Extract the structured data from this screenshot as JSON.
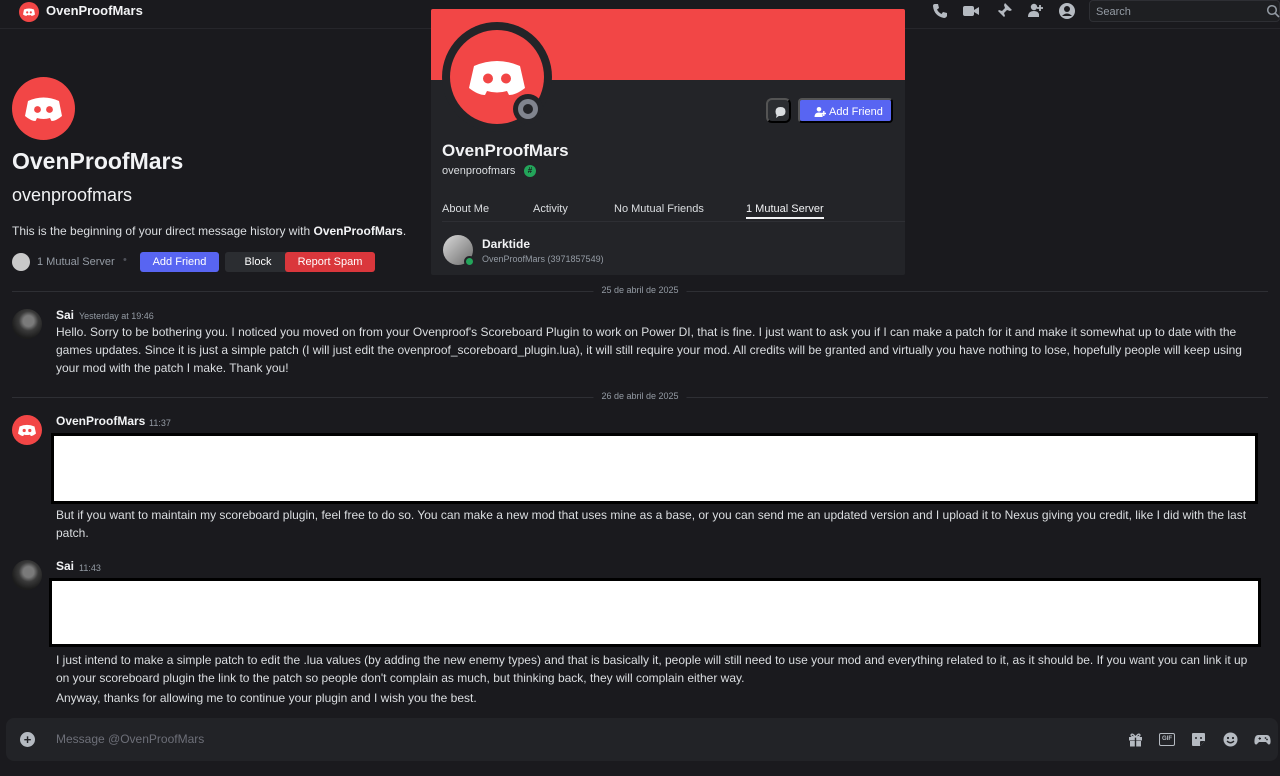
{
  "window": {
    "title": "OvenProofMars"
  },
  "search": {
    "placeholder": "Search"
  },
  "header": {
    "display_name": "OvenProofMars",
    "username": "ovenproofmars",
    "intro_prefix": "This is the beginning of your direct message history with ",
    "intro_name": "OvenProofMars",
    "intro_suffix": ".",
    "mutual_server": "1 Mutual Server",
    "separator": "•",
    "add_friend": "Add Friend",
    "block": "Block",
    "report_spam": "Report Spam"
  },
  "profile_popout": {
    "display_name": "OvenProofMars",
    "username": "ovenproofmars",
    "badge": "#",
    "add_friend": "Add Friend",
    "tabs": [
      {
        "label": "About Me",
        "active": false
      },
      {
        "label": "Activity",
        "active": false
      },
      {
        "label": "No Mutual Friends",
        "active": false
      },
      {
        "label": "1 Mutual Server",
        "active": true
      }
    ],
    "server": {
      "name": "Darktide",
      "nickname": "OvenProofMars (3971857549)"
    }
  },
  "dividers": [
    "25 de abril de 2025",
    "26 de abril de 2025"
  ],
  "messages": [
    {
      "author": "Sai",
      "time": "Yesterday at 19:46",
      "lines": [
        "Hello. Sorry to be bothering you. I noticed you moved on from your Ovenproof's Scoreboard Plugin to work on Power DI, that is fine. I just want to ask you if I can make a patch for it and make it somewhat up to date with the games updates. Since it is just a simple patch (I will just edit the ovenproof_scoreboard_plugin.lua), it will still require your mod. All credits will be granted and virtually you have nothing to lose, hopefully people will keep using your mod with the patch I make. Thank you!"
      ]
    },
    {
      "author": "OvenProofMars",
      "time": "11:37",
      "lines": [
        "But if you want to maintain my scoreboard plugin, feel free to do so. You can make a new mod that uses mine as a base, or you can send me an updated version and I upload it to Nexus giving you credit, like I did with the last patch."
      ]
    },
    {
      "author": "Sai",
      "time": "11:43",
      "lines": [
        "I just intend to make a simple patch to edit the .lua values (by adding the new enemy types) and that is basically it, people will still need to use your mod and everything related to it, as it should be. If you want you can link it up on your scoreboard plugin the link to the patch so people don't complain as much, but thinking back, they will complain either way.",
        "Anyway, thanks for allowing me to continue your plugin and I wish you the best."
      ]
    }
  ],
  "composer": {
    "placeholder": "Message @OvenProofMars"
  },
  "icons": {
    "topbar": [
      "phone-icon",
      "video-icon",
      "pin-icon",
      "add-user-icon",
      "user-profile-icon",
      "search-icon"
    ],
    "composer": [
      "plus-icon",
      "gift-icon",
      "gif-icon",
      "sticker-icon",
      "emoji-icon",
      "game-icon"
    ]
  },
  "colors": {
    "brand_red": "#f24646",
    "blurple": "#5865f2",
    "danger": "#da373c",
    "online": "#23a55a"
  }
}
